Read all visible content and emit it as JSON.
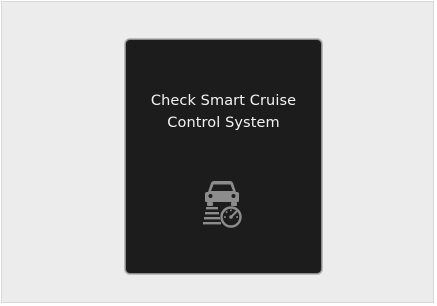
{
  "display": {
    "message_line1": "Check Smart Cruise",
    "message_line2": "Control System",
    "icon": "smart-cruise-control-icon",
    "background_color": "#1c1c1c",
    "text_color": "#f2f2f2",
    "icon_color": "#8c8c8c"
  }
}
